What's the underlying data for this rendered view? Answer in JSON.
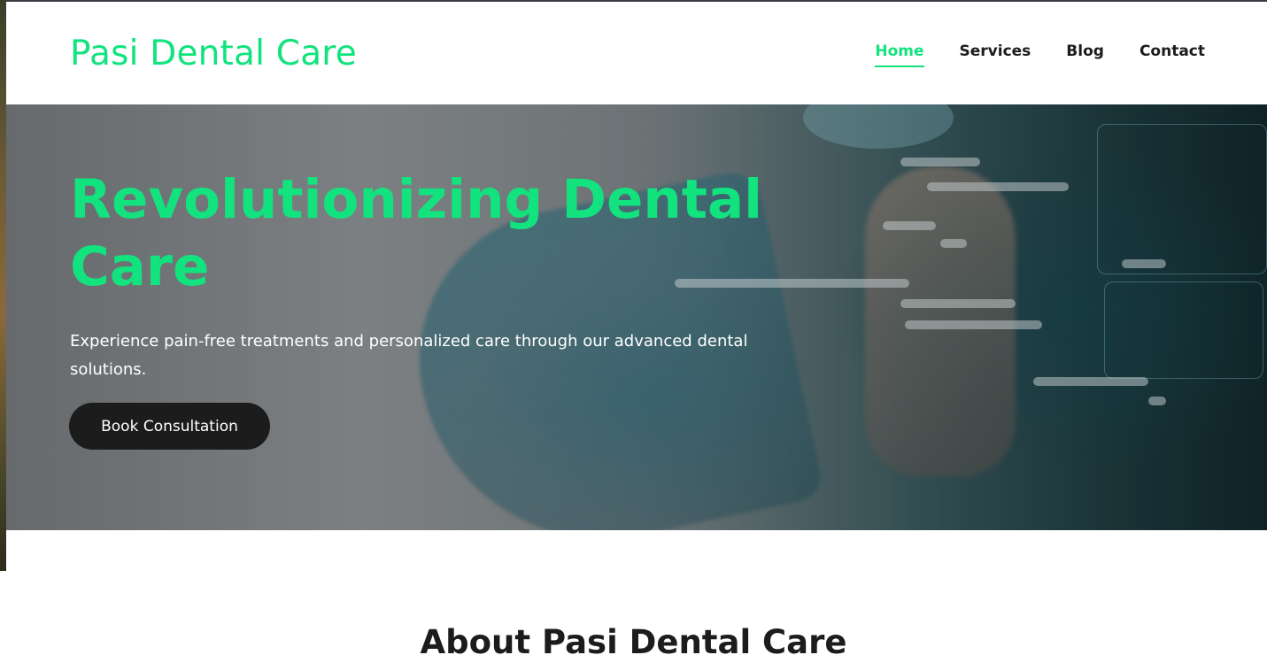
{
  "brand": {
    "name": "Pasi Dental Care",
    "accent_color": "#12e37e"
  },
  "nav": {
    "items": [
      {
        "label": "Home",
        "active": true
      },
      {
        "label": "Services",
        "active": false
      },
      {
        "label": "Blog",
        "active": false
      },
      {
        "label": "Contact",
        "active": false
      }
    ]
  },
  "hero": {
    "title": "Revolutionizing Dental Care",
    "subtitle": "Experience pain-free treatments and personalized care through our advanced dental solutions.",
    "cta_label": "Book Consultation"
  },
  "about": {
    "title": "About Pasi Dental Care"
  }
}
